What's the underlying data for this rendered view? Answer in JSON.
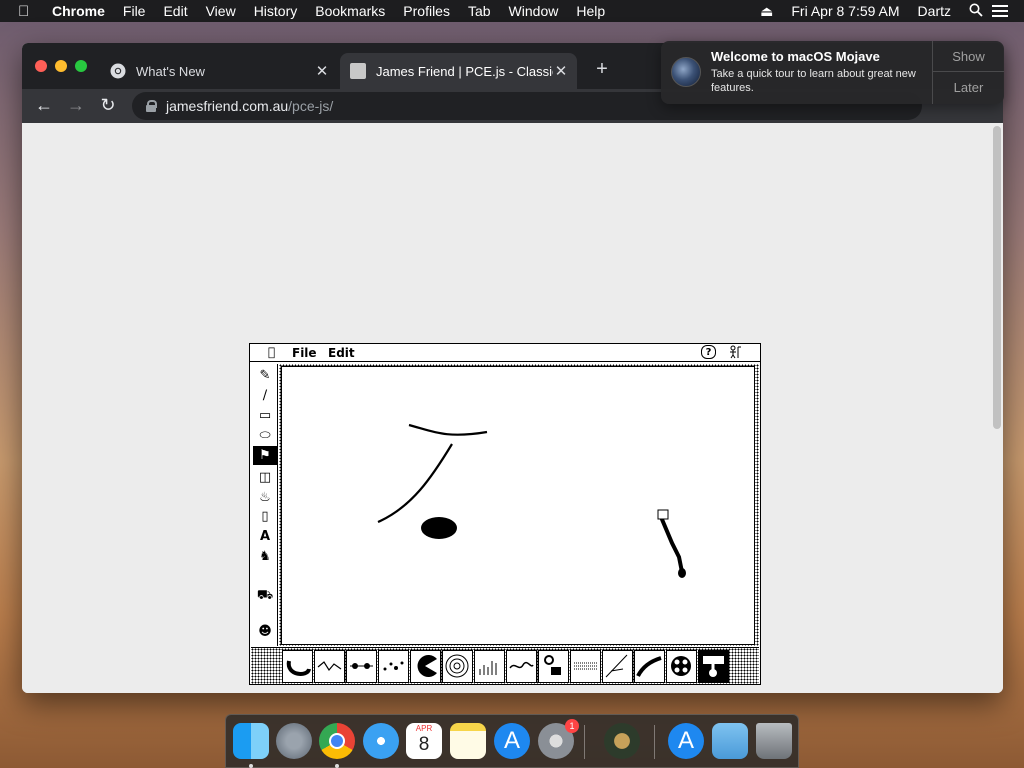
{
  "menubar": {
    "app_name": "Chrome",
    "items": [
      "File",
      "Edit",
      "View",
      "History",
      "Bookmarks",
      "Profiles",
      "Tab",
      "Window",
      "Help"
    ],
    "datetime": "Fri Apr 8  7:59 AM",
    "user": "Dartz"
  },
  "browser": {
    "tabs": [
      {
        "title": "What's New",
        "active": false
      },
      {
        "title": "James Friend | PCE.js - Classic",
        "active": true
      }
    ],
    "url_host": "jamesfriend.com.au",
    "url_path": "/pce-js/"
  },
  "notification": {
    "title": "Welcome to macOS Mojave",
    "body": "Take a quick tour to learn about great new features.",
    "show_label": "Show",
    "later_label": "Later"
  },
  "emulator": {
    "menu_items": [
      "File",
      "Edit"
    ],
    "help_glyph": "?",
    "tools": [
      "pencil-tool",
      "line-tool",
      "rectangle-tool",
      "oval-tool",
      "stamp-tool",
      "spray-can-tool",
      "paint-bucket-tool",
      "eraser-tool",
      "text-tool",
      "rubber-stamp-tool"
    ],
    "text_tool_glyph": "A",
    "selected_tool": "stamp-tool",
    "brush_count": 14
  },
  "dock": {
    "apps": [
      "finder",
      "launchpad",
      "chrome",
      "safari",
      "calendar",
      "notes",
      "app-store",
      "system-preferences",
      "utility",
      "app-store-downloads",
      "downloads-folder",
      "trash"
    ],
    "calendar_month": "APR",
    "calendar_day": "8",
    "system_prefs_badge": "1"
  },
  "colors": {
    "menubar_bg": "#1d1d1f",
    "tabstrip_bg": "#202124",
    "toolbar_bg": "#35363a",
    "content_bg": "#ececec"
  }
}
